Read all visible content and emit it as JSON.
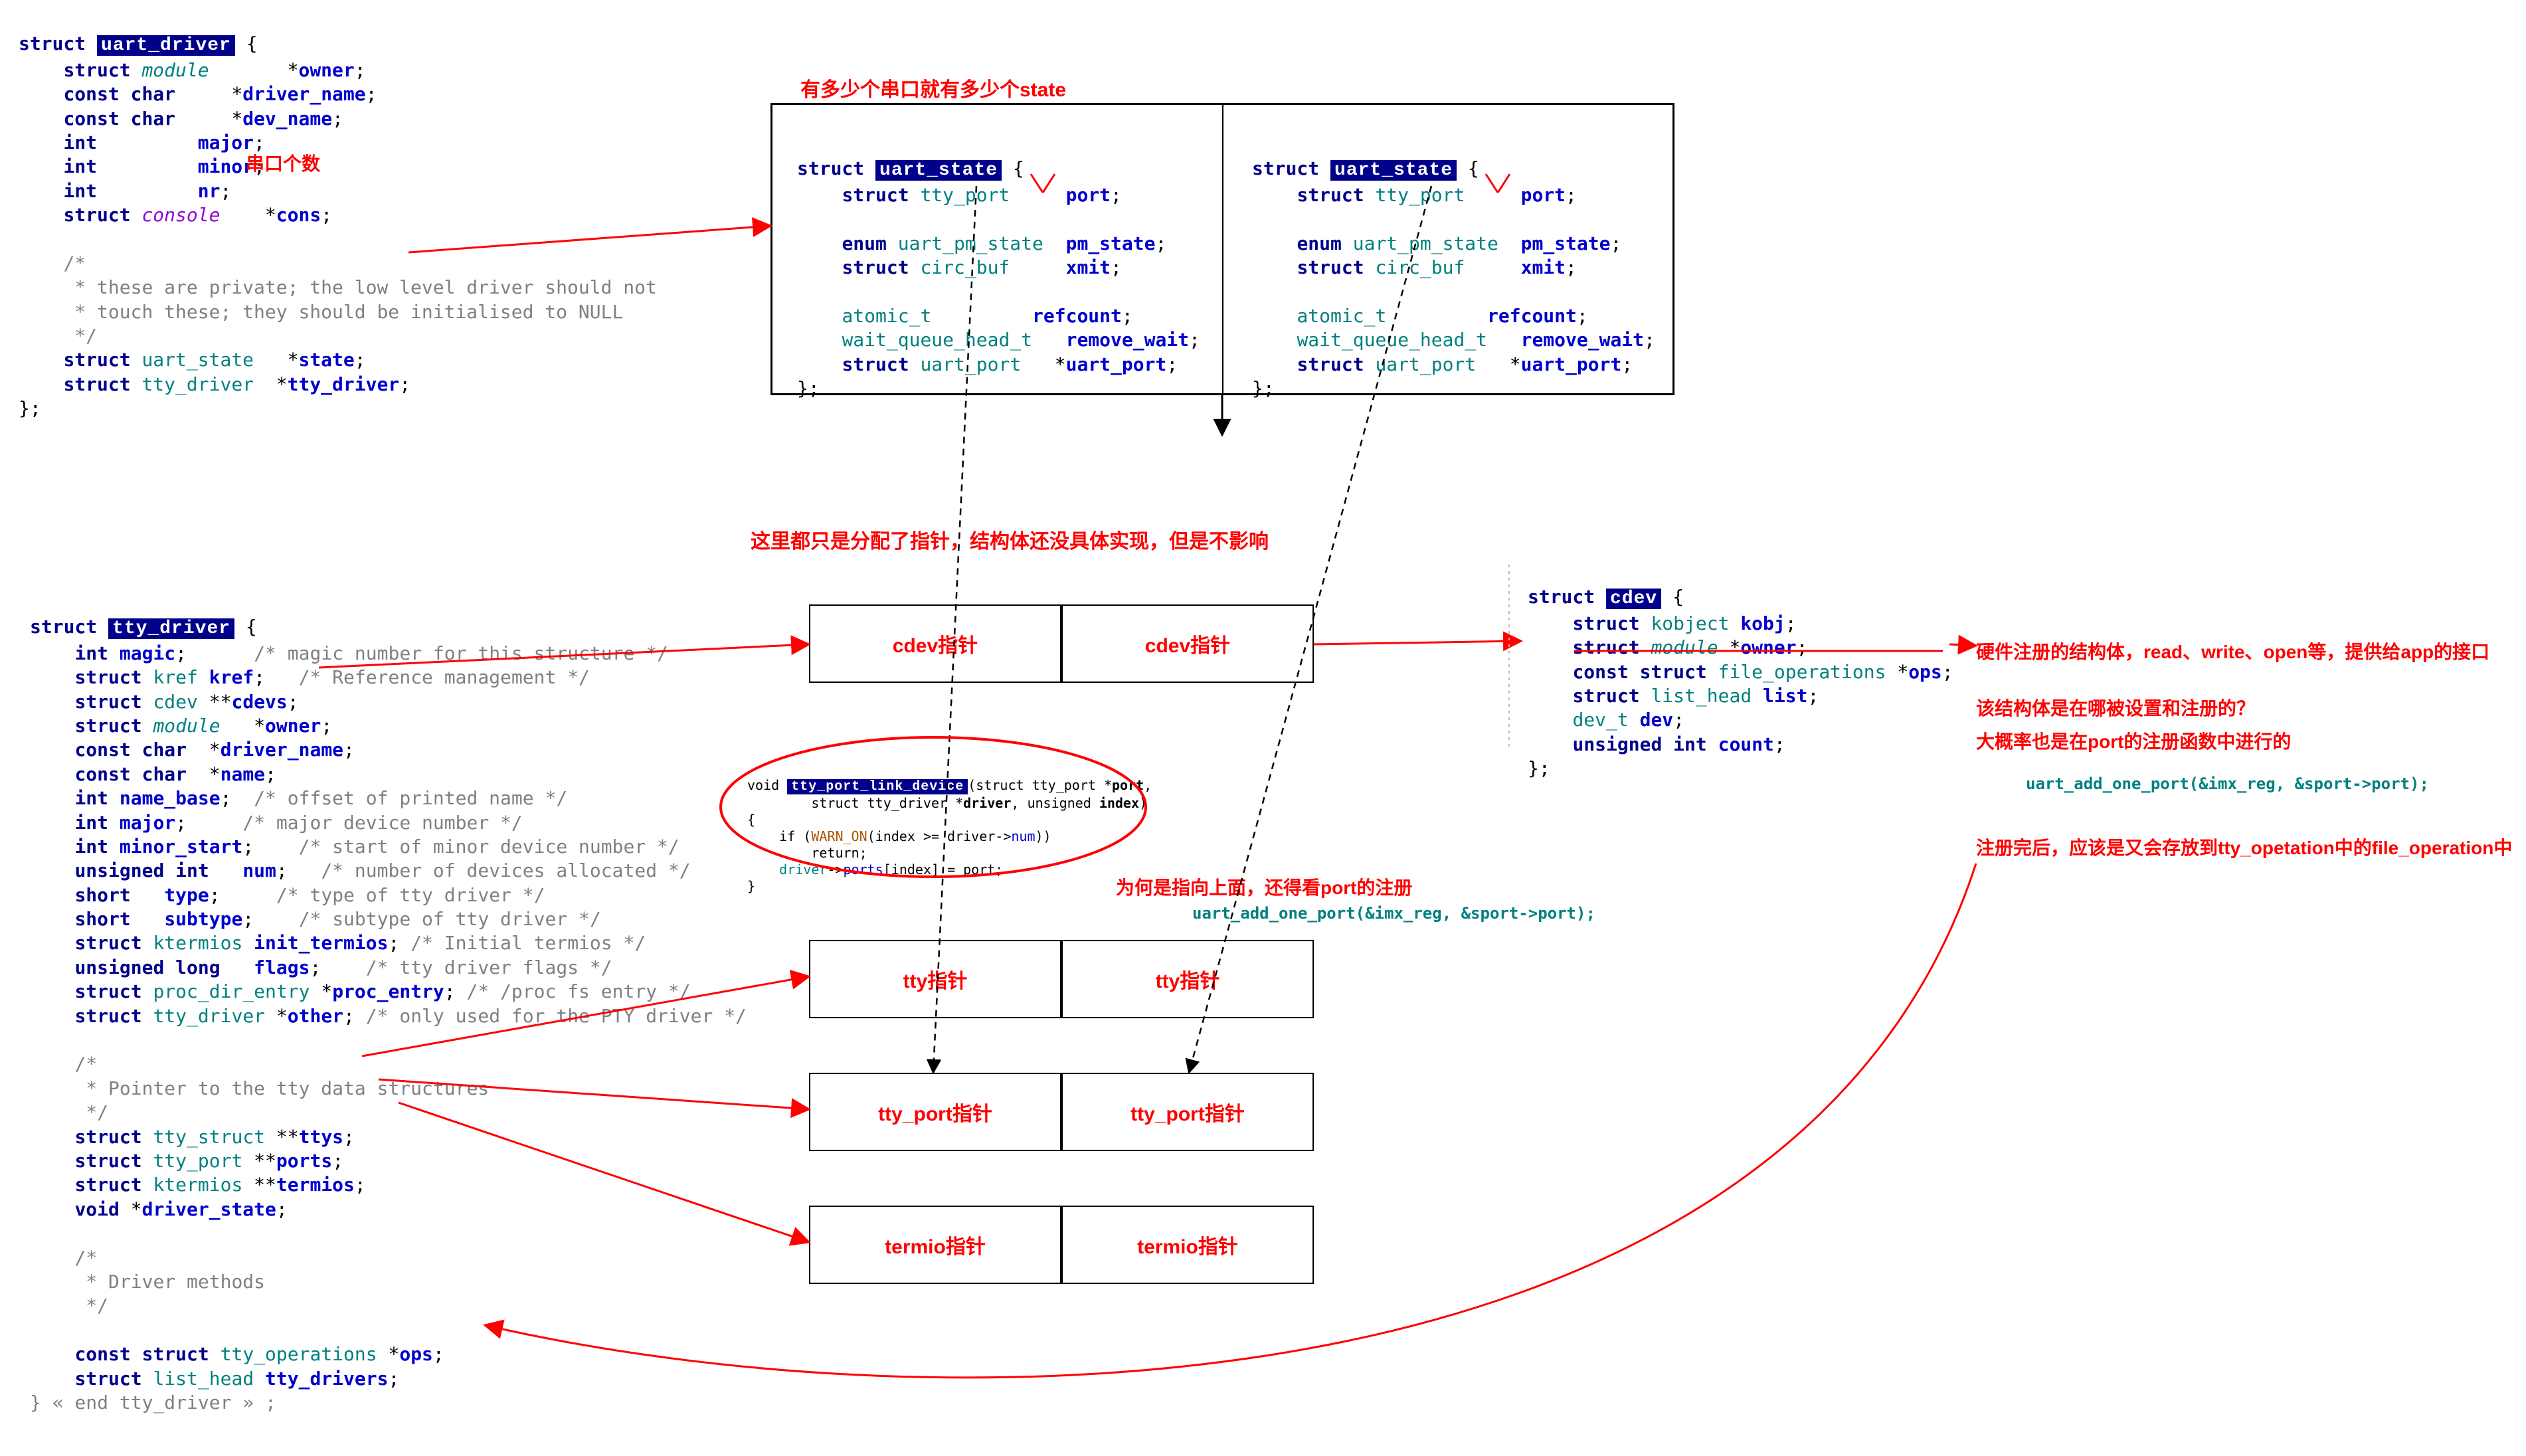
{
  "uart_driver": {
    "title": "uart_driver",
    "lines": [
      "    <span class='kw'>struct</span> <span class='type ital'>module</span>       *<span class='name'>owner</span>;",
      "    <span class='kw'>const</span> <span class='kw'>char</span>     *<span class='name'>driver_name</span>;",
      "    <span class='kw'>const</span> <span class='kw'>char</span>     *<span class='name'>dev_name</span>;",
      "    <span class='kw'>int</span>         <span class='name'>major</span>;",
      "    <span class='kw'>int</span>         <span class='name'>minor</span>;",
      "    <span class='kw'>int</span>         <span class='name'>nr</span>;",
      "    <span class='kw'>struct</span> <span class='kw2'>console</span>    *<span class='name'>cons</span>;",
      "",
      "    <span class='cmt'>/*</span>",
      "    <span class='cmt'> * these are private; the low level driver should not</span>",
      "    <span class='cmt'> * touch these; they should be initialised to NULL</span>",
      "    <span class='cmt'> */</span>",
      "    <span class='kw'>struct</span> <span class='type'>uart_state</span>   *<span class='name'>state</span>;",
      "    <span class='kw'>struct</span> <span class='type'>tty_driver</span>  *<span class='name'>tty_driver</span>;",
      "};"
    ],
    "nr_anno": "串口个数"
  },
  "uart_state_heading": "有多少个串口就有多少个state",
  "uart_state": {
    "title": "uart_state",
    "lines": [
      "    <span class='kw'>struct</span> <span class='type'>tty_port</span>     <span class='name'>port</span>;",
      "",
      "    <span class='kw'>enum</span> <span class='type'>uart_pm_state</span>  <span class='name'>pm_state</span>;",
      "    <span class='kw'>struct</span> <span class='type'>circ_buf</span>     <span class='name'>xmit</span>;",
      "",
      "    <span class='type'>atomic_t</span>         <span class='name'>refcount</span>;",
      "    <span class='type'>wait_queue_head_t</span>   <span class='name'>remove_wait</span>;",
      "    <span class='kw'>struct</span> <span class='type'>uart_port</span>   *<span class='name'>uart_port</span>;",
      "};"
    ]
  },
  "tty_driver": {
    "title": "tty_driver",
    "lines": [
      "    <span class='kw'>int</span> <span class='name'>magic</span>;      <span class='cmt'>/* magic number for this structure */</span>",
      "    <span class='kw'>struct</span> <span class='type'>kref</span> <span class='name'>kref</span>;   <span class='cmt'>/* Reference management */</span>",
      "    <span class='kw'>struct</span> <span class='type'>cdev</span> **<span class='name'>cdevs</span>;",
      "    <span class='kw'>struct</span> <span class='type ital'>module</span>   *<span class='name'>owner</span>;",
      "    <span class='kw'>const</span> <span class='kw'>char</span>  *<span class='name'>driver_name</span>;",
      "    <span class='kw'>const</span> <span class='kw'>char</span>  *<span class='name'>name</span>;",
      "    <span class='kw'>int</span> <span class='name'>name_base</span>;  <span class='cmt'>/* offset of printed name */</span>",
      "    <span class='kw'>int</span> <span class='name'>major</span>;     <span class='cmt'>/* major device number */</span>",
      "    <span class='kw'>int</span> <span class='name'>minor_start</span>;    <span class='cmt'>/* start of minor device number */</span>",
      "    <span class='kw'>unsigned</span> <span class='kw'>int</span>   <span class='name'>num</span>;   <span class='cmt'>/* number of devices allocated */</span>",
      "    <span class='kw'>short</span>   <span class='name'>type</span>;     <span class='cmt'>/* type of tty driver */</span>",
      "    <span class='kw'>short</span>   <span class='name'>subtype</span>;    <span class='cmt'>/* subtype of tty driver */</span>",
      "    <span class='kw'>struct</span> <span class='type'>ktermios</span> <span class='name'>init_termios</span>; <span class='cmt'>/* Initial termios */</span>",
      "    <span class='kw'>unsigned</span> <span class='kw'>long</span>   <span class='name'>flags</span>;    <span class='cmt'>/* tty driver flags */</span>",
      "    <span class='kw'>struct</span> <span class='type'>proc_dir_entry</span> *<span class='name'>proc_entry</span>; <span class='cmt'>/* /proc fs entry */</span>",
      "    <span class='kw'>struct</span> <span class='type'>tty_driver</span> *<span class='name'>other</span>; <span class='cmt'>/* only used for the PTY driver */</span>",
      "",
      "    <span class='cmt'>/*</span>",
      "    <span class='cmt'> * Pointer to the tty data structures</span>",
      "    <span class='cmt'> */</span>",
      "    <span class='kw'>struct</span> <span class='type'>tty_struct</span> **<span class='name'>ttys</span>;",
      "    <span class='kw'>struct</span> <span class='type'>tty_port</span> **<span class='name'>ports</span>;",
      "    <span class='kw'>struct</span> <span class='type'>ktermios</span> **<span class='name'>termios</span>;",
      "    <span class='kw'>void</span> *<span class='name'>driver_state</span>;",
      "",
      "    <span class='cmt'>/*</span>",
      "    <span class='cmt'> * Driver methods</span>",
      "    <span class='cmt'> */</span>",
      "",
      "    <span class='kw'>const</span> <span class='kw'>struct</span> <span class='type'>tty_operations</span> *<span class='name'>ops</span>;",
      "    <span class='kw'>struct</span> <span class='type'>list_head</span> <span class='name'>tty_drivers</span>;",
      "<span class='cmt'>} « end tty_driver » ;</span>"
    ]
  },
  "cdev": {
    "title": "cdev",
    "lines": [
      "    <span class='kw'>struct</span> <span class='type'>kobject</span> <span class='name'>kobj</span>;",
      "    <span class='kw'>struct</span> <span class='type ital'>module</span> *<span class='name'>owner</span>;",
      "    <span class='kw'>const</span> <span class='kw'>struct</span> <span class='type'>file_operations</span> *<span class='name'>ops</span>;",
      "    <span class='kw'>struct</span> <span class='type'>list_head</span> <span class='name'>list</span>;",
      "    <span class='type'>dev_t</span> <span class='name'>dev</span>;",
      "    <span class='kw'>unsigned</span> <span class='kw'>int</span> <span class='name'>count</span>;",
      "};"
    ]
  },
  "cells": {
    "cdev1": "cdev指针",
    "cdev2": "cdev指针",
    "tty1": "tty指针",
    "tty2": "tty指针",
    "ttyport1": "tty_port指针",
    "ttyport2": "tty_port指针",
    "term1": "termio指针",
    "term2": "termio指针"
  },
  "anno": {
    "alloc_ptr": "这里都只是分配了指针，结构体还没具体实现，但是不影响",
    "why_up": "为何是指向上面，还得看port的注册",
    "hw_register": "硬件注册的结构体，read、write、open等，提供给app的接口",
    "where_set": "该结构体是在哪被设置和注册的？",
    "probably": "大概率也是在port的注册函数中进行的",
    "after_reg": "注册完后，应该是又会存放到tty_opetation中的file_operation中"
  },
  "calls": {
    "add_one_port1": "uart_add_one_port(&<b>imx_reg</b>, &sport-&gt;port);",
    "add_one_port2": "uart_add_one_port(&<b>imx_reg</b>, &sport-&gt;port);"
  },
  "linkdev": {
    "sig1": "void <span class='hlbox'>tty_port_link_device</span>(struct tty_port *<b>port</b>,",
    "sig2": "        struct tty_driver *<b>driver</b>, unsigned <b>index</b>)",
    "body1": "{",
    "body2": "    if (<span style='color:#aa5500'>WARN_ON</span>(index &gt;= driver-&gt;<span style='color:#0000cd'>num</span>))",
    "body3": "        return;",
    "body4": "    <span style='color:#008080'>driver</span>-&gt;<span style='color:#0000cd'>ports</span>[index] = port;",
    "body5": "}"
  }
}
